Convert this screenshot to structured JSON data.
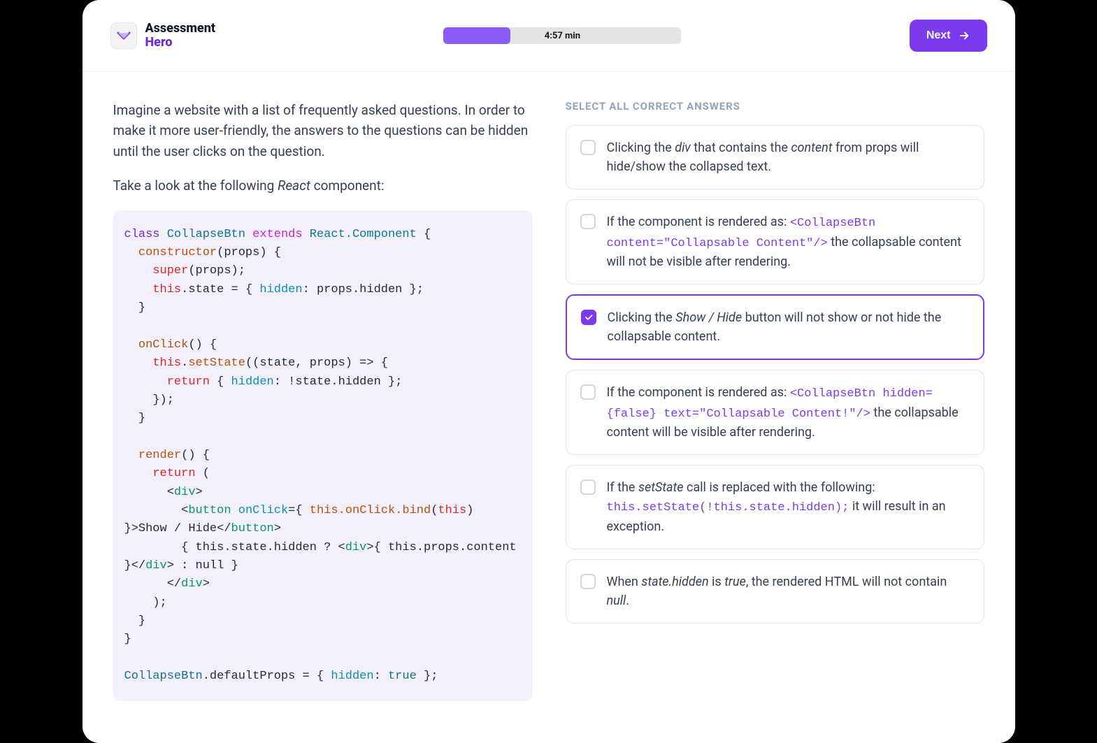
{
  "brand": {
    "line1": "Assessment",
    "line2": "Hero"
  },
  "timer": {
    "label": "4:57 min",
    "progress_percent": 28
  },
  "next_button": {
    "label": "Next"
  },
  "question": {
    "para1": "Imagine a website with a list of frequently asked questions. In order to make it more user-friendly, the answers to the questions can be hidden until the user clicks on the question.",
    "para2_pre": "Take a look at the following ",
    "para2_em": "React",
    "para2_post": " component:"
  },
  "code": {
    "class_kw": "class",
    "class_name": "CollapseBtn",
    "extends_kw": "extends",
    "react_comp": "React.Component",
    "constructor_fn": "constructor",
    "constructor_args": "(props) {",
    "super_kw": "super",
    "super_args": "(props);",
    "this_kw": "this",
    "state_assign": ".state = { ",
    "hidden_prop": "hidden",
    "state_rest": ": props.hidden };",
    "onclick_fn": "onClick",
    "onclick_sig": "() {",
    "setstate_fn": "setState",
    "setstate_args": "((state, props) => {",
    "return_kw": "return",
    "return_obj_open": " { ",
    "return_hidden": "hidden",
    "return_rest": ": !state.hidden };",
    "close_fn": "});",
    "render_fn": "render",
    "render_sig": "() {",
    "render_return": "return",
    "render_open": " (",
    "div_open": "div",
    "button_tag": "button",
    "onclick_attr": "onClick",
    "onclick_eq": "={ ",
    "bind_call": "this.onClick.bind",
    "bind_this": "this",
    "btn_text": ">Show / Hide</",
    "state_check": "{ this.state.hidden ? <",
    "content_expr": ">{ this.props.content }</",
    "null_end": "> : null }",
    "default_props_pre": "CollapseBtn",
    "default_props_mid": ".defaultProps = { ",
    "default_hidden": "hidden",
    "default_colon": ": ",
    "true_kw": "true",
    "default_end": " };"
  },
  "answers": {
    "title": "SELECT ALL CORRECT ANSWERS",
    "options": [
      {
        "selected": false,
        "segments": [
          {
            "t": "text",
            "v": "Clicking the "
          },
          {
            "t": "em",
            "v": "div"
          },
          {
            "t": "text",
            "v": " that contains the "
          },
          {
            "t": "em",
            "v": "content"
          },
          {
            "t": "text",
            "v": " from props will hide/show the collapsed text."
          }
        ]
      },
      {
        "selected": false,
        "segments": [
          {
            "t": "text",
            "v": "If the component is rendered as: "
          },
          {
            "t": "code",
            "v": "<CollapseBtn content=\"Collapsable Content\"/>"
          },
          {
            "t": "text",
            "v": " the collapsable content will not be visible after rendering."
          }
        ]
      },
      {
        "selected": true,
        "segments": [
          {
            "t": "text",
            "v": "Clicking the "
          },
          {
            "t": "em",
            "v": "Show / Hide"
          },
          {
            "t": "text",
            "v": " button will not show or not hide the collapsable content."
          }
        ]
      },
      {
        "selected": false,
        "segments": [
          {
            "t": "text",
            "v": "If the component is rendered as: "
          },
          {
            "t": "code",
            "v": "<CollapseBtn hidden={false} text=\"Collapsable Content!\"/>"
          },
          {
            "t": "text",
            "v": " the collapsable content will be visible after rendering."
          }
        ]
      },
      {
        "selected": false,
        "segments": [
          {
            "t": "text",
            "v": "If the "
          },
          {
            "t": "em",
            "v": "setState"
          },
          {
            "t": "text",
            "v": " call is replaced with the following: "
          },
          {
            "t": "code",
            "v": "this.setState(!this.state.hidden);"
          },
          {
            "t": "text",
            "v": " it will result in an exception."
          }
        ]
      },
      {
        "selected": false,
        "segments": [
          {
            "t": "text",
            "v": "When "
          },
          {
            "t": "em",
            "v": "state.hidden"
          },
          {
            "t": "text",
            "v": " is "
          },
          {
            "t": "em",
            "v": "true"
          },
          {
            "t": "text",
            "v": ", the rendered HTML will not contain "
          },
          {
            "t": "em",
            "v": "null"
          },
          {
            "t": "text",
            "v": "."
          }
        ]
      }
    ]
  }
}
